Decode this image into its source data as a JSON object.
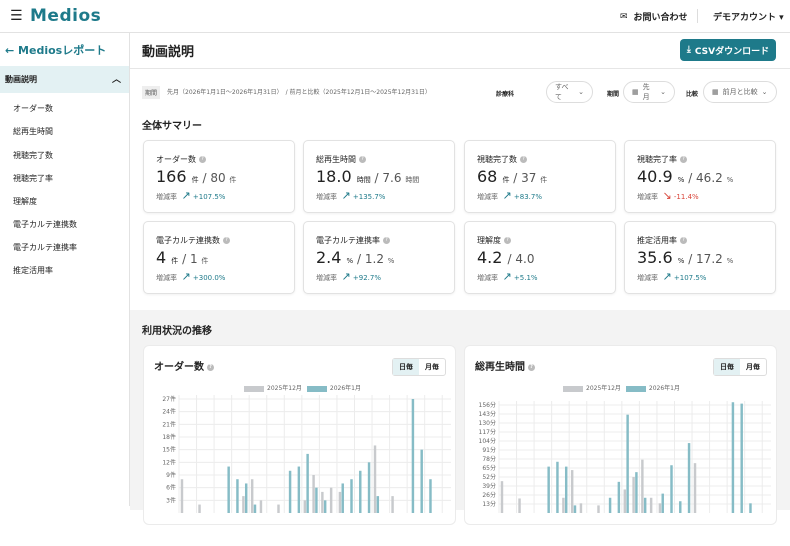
{
  "header": {
    "logo": "Medios",
    "contact": "お問い合わせ",
    "account": "デモアカウント ▾"
  },
  "sidebar": {
    "back": "← Mediosレポート",
    "section": "動画説明",
    "items": [
      "オーダー数",
      "総再生時間",
      "視聴完了数",
      "視聴完了率",
      "理解度",
      "電子カルテ連携数",
      "電子カルテ連携率",
      "推定活用率"
    ]
  },
  "page": {
    "title": "動画説明",
    "csv_label": "CSVダウンロード"
  },
  "filters": {
    "period_tag": "期間",
    "period_text": "先月（2026年1月1日〜2026年1月31日）　/ 前月と比較（2025年12月1日〜2025年12月31日）",
    "dept_label": "診療科",
    "dept_value": "すべて",
    "period_label": "期間",
    "period_value": "先月",
    "compare_label": "比較",
    "compare_value": "前月と比較"
  },
  "summary": {
    "heading": "全体サマリー",
    "rate_label": "増減率",
    "cards": [
      {
        "label": "オーダー数",
        "value": "166",
        "unit": "件",
        "prev": "80",
        "prev_unit": "件",
        "rate": "+107.5%",
        "dir": "up"
      },
      {
        "label": "総再生時間",
        "value": "18.0",
        "unit": "時間",
        "prev": "7.6",
        "prev_unit": "時間",
        "rate": "+135.7%",
        "dir": "up"
      },
      {
        "label": "視聴完了数",
        "value": "68",
        "unit": "件",
        "prev": "37",
        "prev_unit": "件",
        "rate": "+83.7%",
        "dir": "up"
      },
      {
        "label": "視聴完了率",
        "value": "40.9",
        "unit": "%",
        "prev": "46.2",
        "prev_unit": "%",
        "rate": "-11.4%",
        "dir": "down"
      },
      {
        "label": "電子カルテ連携数",
        "value": "4",
        "unit": "件",
        "prev": "1",
        "prev_unit": "件",
        "rate": "+300.0%",
        "dir": "up"
      },
      {
        "label": "電子カルテ連携率",
        "value": "2.4",
        "unit": "%",
        "prev": "1.2",
        "prev_unit": "%",
        "rate": "+92.7%",
        "dir": "up"
      },
      {
        "label": "理解度",
        "value": "4.2",
        "unit": "",
        "prev": "4.0",
        "prev_unit": "",
        "rate": "+5.1%",
        "dir": "up"
      },
      {
        "label": "推定活用率",
        "value": "35.6",
        "unit": "%",
        "prev": "17.2",
        "prev_unit": "%",
        "rate": "+107.5%",
        "dir": "up"
      }
    ]
  },
  "trend": {
    "heading": "利用状況の推移",
    "daily": "日毎",
    "monthly": "月毎"
  },
  "colors": {
    "accent": "#1e7a8a",
    "prev": "#c8cacd",
    "curr": "#86bcc6",
    "down": "#d9453a"
  },
  "chart_data": [
    {
      "type": "bar",
      "title": "オーダー数",
      "legend": [
        "2025年12月",
        "2026年1月"
      ],
      "unit": "件",
      "yticks": [
        3,
        6,
        9,
        12,
        15,
        18,
        21,
        24,
        27
      ],
      "ylim": [
        0,
        27
      ],
      "series": [
        {
          "name": "2025年12月",
          "values": [
            8,
            0,
            2,
            0,
            0,
            0,
            0,
            4,
            8,
            3,
            0,
            2,
            0,
            0,
            3,
            9,
            5,
            6,
            5,
            0,
            0,
            0,
            16,
            0,
            4,
            0,
            0,
            0,
            0,
            0,
            0
          ]
        },
        {
          "name": "2026年1月",
          "values": [
            0,
            0,
            0,
            0,
            0,
            11,
            8,
            7,
            2,
            0,
            0,
            0,
            10,
            11,
            14,
            6,
            3,
            0,
            7,
            8,
            10,
            12,
            4,
            0,
            0,
            0,
            27,
            15,
            8,
            0,
            0
          ]
        }
      ]
    },
    {
      "type": "bar",
      "title": "総再生時間",
      "legend": [
        "2025年12月",
        "2026年1月"
      ],
      "unit": "分",
      "yticks": [
        13,
        26,
        39,
        52,
        65,
        78,
        91,
        104,
        117,
        130,
        143,
        156
      ],
      "ylim": [
        0,
        160
      ],
      "series": [
        {
          "name": "2025年12月",
          "values": [
            46,
            0,
            21,
            0,
            0,
            0,
            0,
            22,
            62,
            14,
            0,
            11,
            0,
            0,
            34,
            52,
            77,
            22,
            14,
            0,
            0,
            0,
            72,
            0,
            0,
            0,
            0,
            0,
            0,
            0,
            0
          ]
        },
        {
          "name": "2026年1月",
          "values": [
            0,
            0,
            0,
            0,
            0,
            67,
            74,
            67,
            11,
            0,
            0,
            0,
            22,
            45,
            142,
            59,
            22,
            0,
            28,
            69,
            17,
            101,
            0,
            0,
            0,
            0,
            160,
            158,
            14,
            0,
            0
          ]
        }
      ]
    }
  ]
}
